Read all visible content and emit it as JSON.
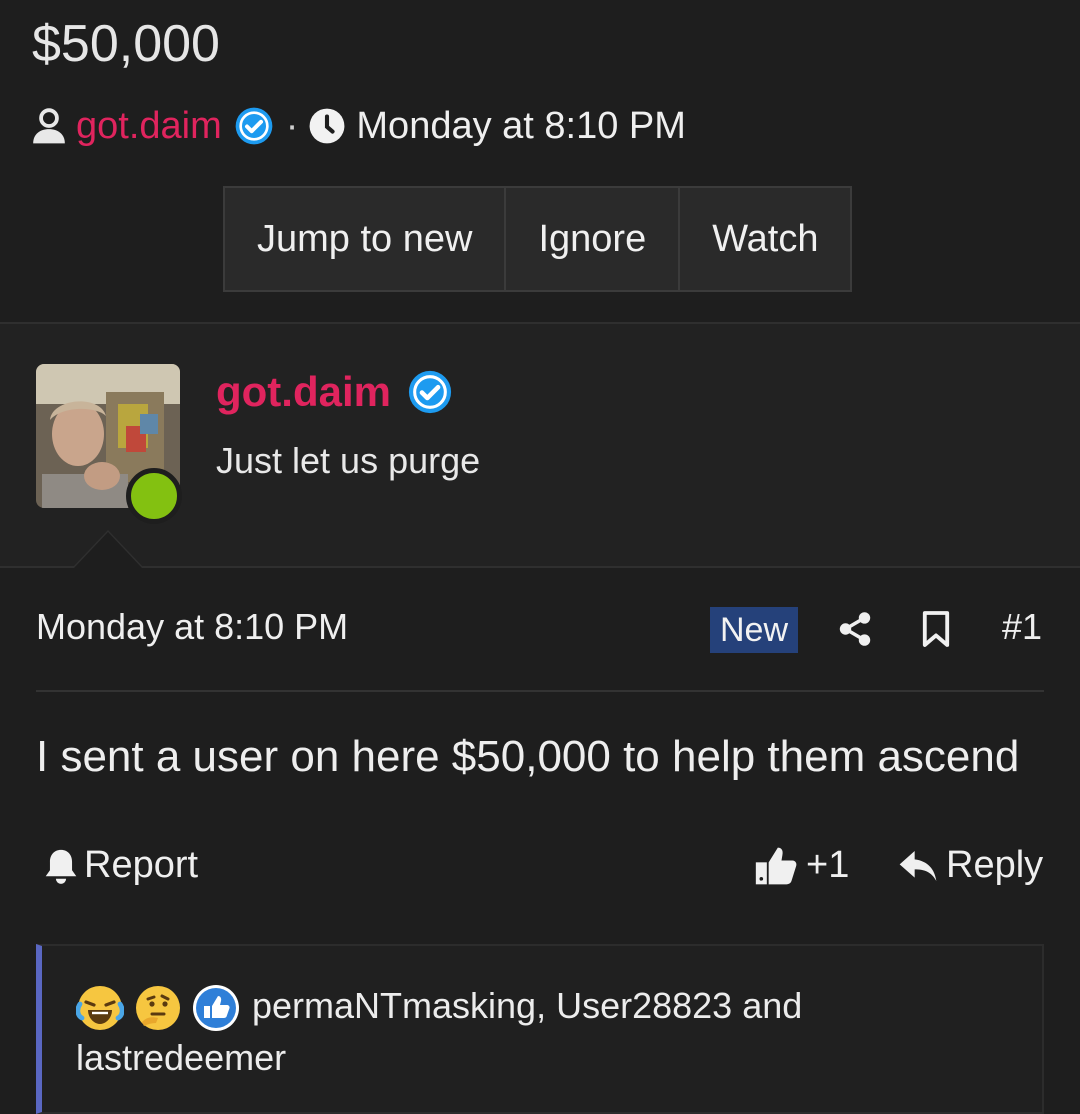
{
  "thread": {
    "title": "$50,000",
    "author": "got.daim",
    "separator": "·",
    "date": "Monday at 8:10 PM"
  },
  "buttons": {
    "jump": "Jump to new",
    "ignore": "Ignore",
    "watch": "Watch"
  },
  "post": {
    "author": "got.daim",
    "user_title": "Just let us purge",
    "date": "Monday at 8:10 PM",
    "badge": "New",
    "number": "#1",
    "body": "I sent a user on here $50,000 to help them ascend",
    "report_label": "Report",
    "like_count": "+1",
    "reply_label": "Reply"
  },
  "reactions": {
    "icons": [
      "laugh-cry-emoji-icon",
      "thinking-emoji-icon",
      "thumbs-up-reaction-icon"
    ],
    "text": "permaNTmasking, User28823 and lastredeemer"
  },
  "colors": {
    "background": "#1e1e1e",
    "author": "#e0245e",
    "verified": "#1d9bf0",
    "online": "#83c111",
    "new_badge": "#25417a",
    "reaction_accent": "#5a67c2"
  }
}
